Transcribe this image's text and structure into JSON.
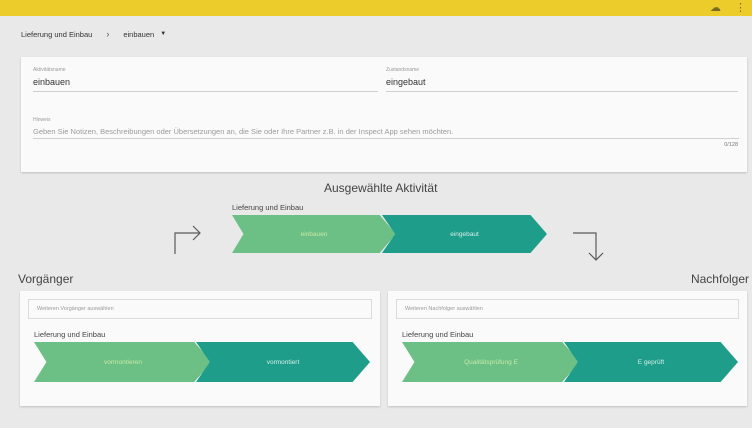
{
  "topbar": {
    "cloud_icon": "cloud-icon",
    "menu_icon": "more-vert-icon",
    "color": "#eccc2a"
  },
  "breadcrumb": {
    "parent": "Lieferung und Einbau",
    "current": "einbauen"
  },
  "form": {
    "activity_label": "Aktivitätsname",
    "activity_value": "einbauen",
    "state_label": "Zustandsname",
    "state_value": "eingebaut",
    "notes_label": "Hinweis",
    "notes_placeholder": "Geben Sie Notizen, Beschreibungen oder Übersetzungen an, die Sie oder Ihre Partner z.B. in der Inspect App sehen möchten.",
    "counter": "0/128"
  },
  "selected": {
    "title": "Ausgewählte Aktivität",
    "process": "Lieferung und Einbau",
    "activity": "einbauen",
    "state": "eingebaut"
  },
  "predecessor": {
    "title": "Vorgänger",
    "select_placeholder": "Weiteren Vorgänger auswählen",
    "process": "Lieferung und Einbau",
    "activity": "vormontieren",
    "state": "vormontiert"
  },
  "successor": {
    "title": "Nachfolger",
    "select_placeholder": "Weiteren Nachfolger auswählen",
    "process": "Lieferung und Einbau",
    "activity": "Qualitätsprüfung E",
    "state": "E geprüft"
  },
  "colors": {
    "activity": "#6dc085",
    "state": "#1e9d8a"
  }
}
